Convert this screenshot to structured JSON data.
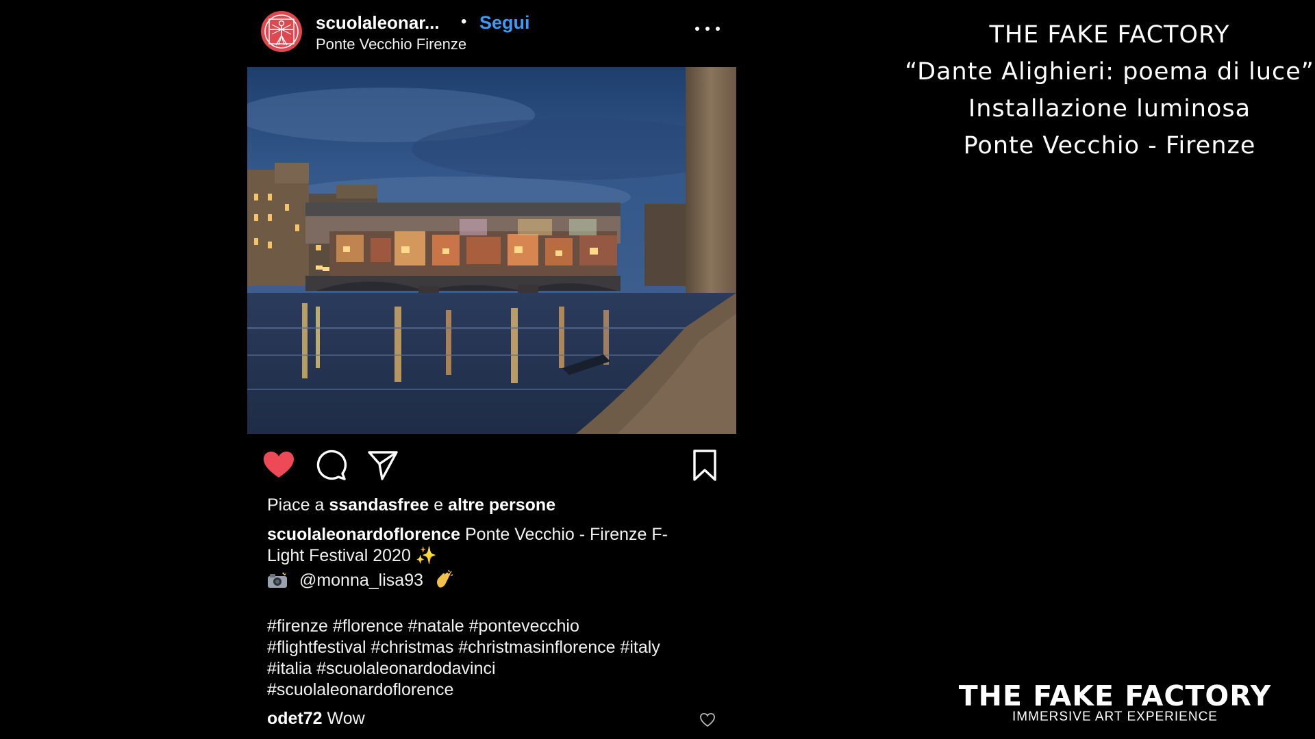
{
  "post": {
    "username": "scuolaleonar...",
    "separator": "•",
    "follow_label": "Segui",
    "location": "Ponte Vecchio Firenze",
    "more_icon": "more-horizontal-icon",
    "photo_alt": "Ponte Vecchio illuminato di notte sull'Arno",
    "liked": true,
    "likes": {
      "prefix": "Piace a",
      "user": "ssandasfree",
      "conj": "e",
      "others": "altre persone"
    },
    "caption": {
      "user": "scuolaleonardoflorence",
      "line1": "Ponte Vecchio - Firenze F-",
      "line2": "Light Festival 2020 ✨",
      "mention": "@monna_lisa93"
    },
    "hashtags": [
      "#firenze #florence #natale #pontevecchio",
      "#flightfestival #christmas #christmasinflorence #italy",
      "#italia #scuolaleonardodavinci",
      "#scuolaleonardoflorence"
    ],
    "comment": {
      "user": "odet72",
      "text": "Wow"
    }
  },
  "title_block": {
    "line1": "THE FAKE FACTORY",
    "line2": "“Dante Alighieri: poema di luce”",
    "line3": "Installazione luminosa",
    "line4": "Ponte Vecchio - Firenze"
  },
  "logo": {
    "main": "THE FAKE FACTORY",
    "sub": "IMMERSIVE ART EXPERIENCE"
  },
  "colors": {
    "background": "#000000",
    "follow_blue": "#3d9bf5",
    "heart_red": "#ed4956",
    "avatar_red": "#e0484f"
  }
}
